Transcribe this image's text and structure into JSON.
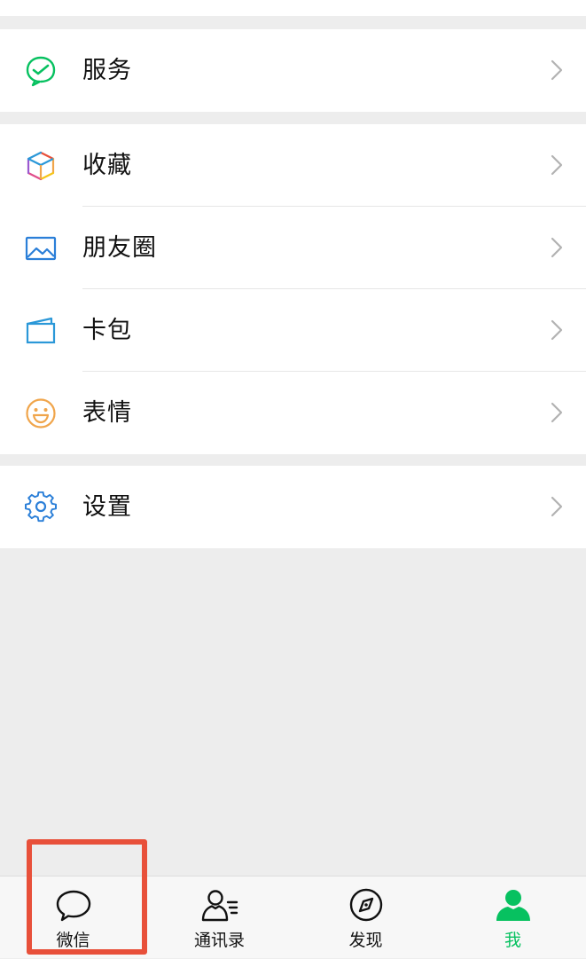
{
  "menu": {
    "services": {
      "label": "服务",
      "icon": "wechat-pay-icon",
      "color": "#07c160"
    },
    "favorites": {
      "label": "收藏",
      "icon": "cube-icon"
    },
    "moments": {
      "label": "朋友圈",
      "icon": "picture-icon",
      "color": "#2b7fd8"
    },
    "cards": {
      "label": "卡包",
      "icon": "card-wallet-icon",
      "color": "#2b98d8"
    },
    "stickers": {
      "label": "表情",
      "icon": "smiley-icon",
      "color": "#f0a54b"
    },
    "settings": {
      "label": "设置",
      "icon": "gear-icon",
      "color": "#2b7fd8"
    }
  },
  "tabbar": {
    "chats": {
      "label": "微信",
      "icon": "chat-bubble-icon"
    },
    "contacts": {
      "label": "通讯录",
      "icon": "contacts-icon"
    },
    "discover": {
      "label": "发现",
      "icon": "compass-icon"
    },
    "me": {
      "label": "我",
      "icon": "person-icon",
      "active": true,
      "color": "#07c160"
    }
  },
  "highlight": {
    "color": "#e8503a"
  }
}
